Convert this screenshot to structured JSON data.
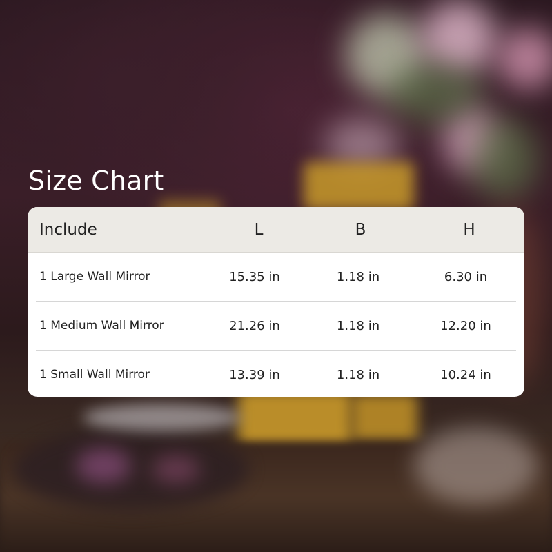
{
  "title": "Size Chart",
  "table": {
    "headers": {
      "include": "Include",
      "l": "L",
      "b": "B",
      "h": "H"
    },
    "rows": [
      {
        "include": "1 Large Wall Mirror",
        "l": "15.35 in",
        "b": "1.18 in",
        "h": "6.30 in"
      },
      {
        "include": "1 Medium Wall Mirror",
        "l": "21.26 in",
        "b": "1.18 in",
        "h": "12.20 in"
      },
      {
        "include": "1 Small Wall Mirror",
        "l": "13.39 in",
        "b": "1.18 in",
        "h": "10.24 in"
      }
    ]
  },
  "colors": {
    "header_bg": "#eceae5",
    "card_bg": "#ffffff",
    "title_text": "#ffffff",
    "cell_text": "#222222"
  }
}
